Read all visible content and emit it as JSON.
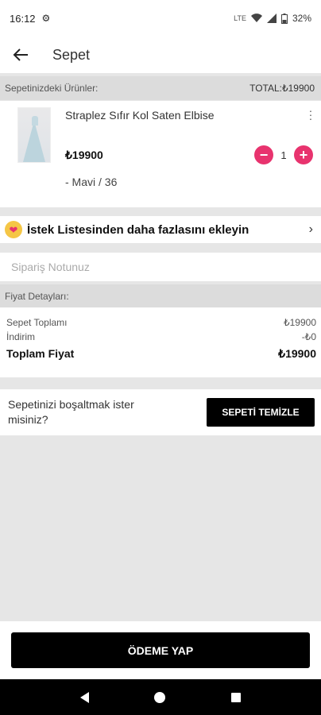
{
  "status": {
    "time": "16:12",
    "battery": "32%",
    "network_label": "LTE"
  },
  "header": {
    "title": "Sepet"
  },
  "cart": {
    "section_label": "Sepetinizdeki Ürünler:",
    "total_label": "TOTAL:₺19900"
  },
  "product": {
    "name": "Straplez Sıfır Kol Saten Elbise",
    "price": "₺19900",
    "quantity": "1",
    "variant": "- Mavi / 36",
    "image_icon": "dress-image"
  },
  "wishlist": {
    "label": "İstek Listesinden daha fazlasını ekleyin"
  },
  "note": {
    "placeholder": "Sipariş Notunuz",
    "value": ""
  },
  "price_details": {
    "section_label": "Fiyat Detayları:",
    "rows": [
      {
        "label": "Sepet Toplamı",
        "value": "₺19900"
      },
      {
        "label": "İndirim",
        "value": "-₺0"
      }
    ],
    "total_label": "Toplam Fiyat",
    "total_value": "₺19900"
  },
  "clear": {
    "question": "Sepetinizi boşaltmak ister misiniz?",
    "button": "SEPETİ TEMİZLE"
  },
  "checkout": {
    "button": "ÖDEME YAP"
  },
  "colors": {
    "accent": "#e8336e",
    "primary_button": "#000000",
    "section_bg": "#dcdcdc",
    "heart_bg": "#f5c646"
  }
}
